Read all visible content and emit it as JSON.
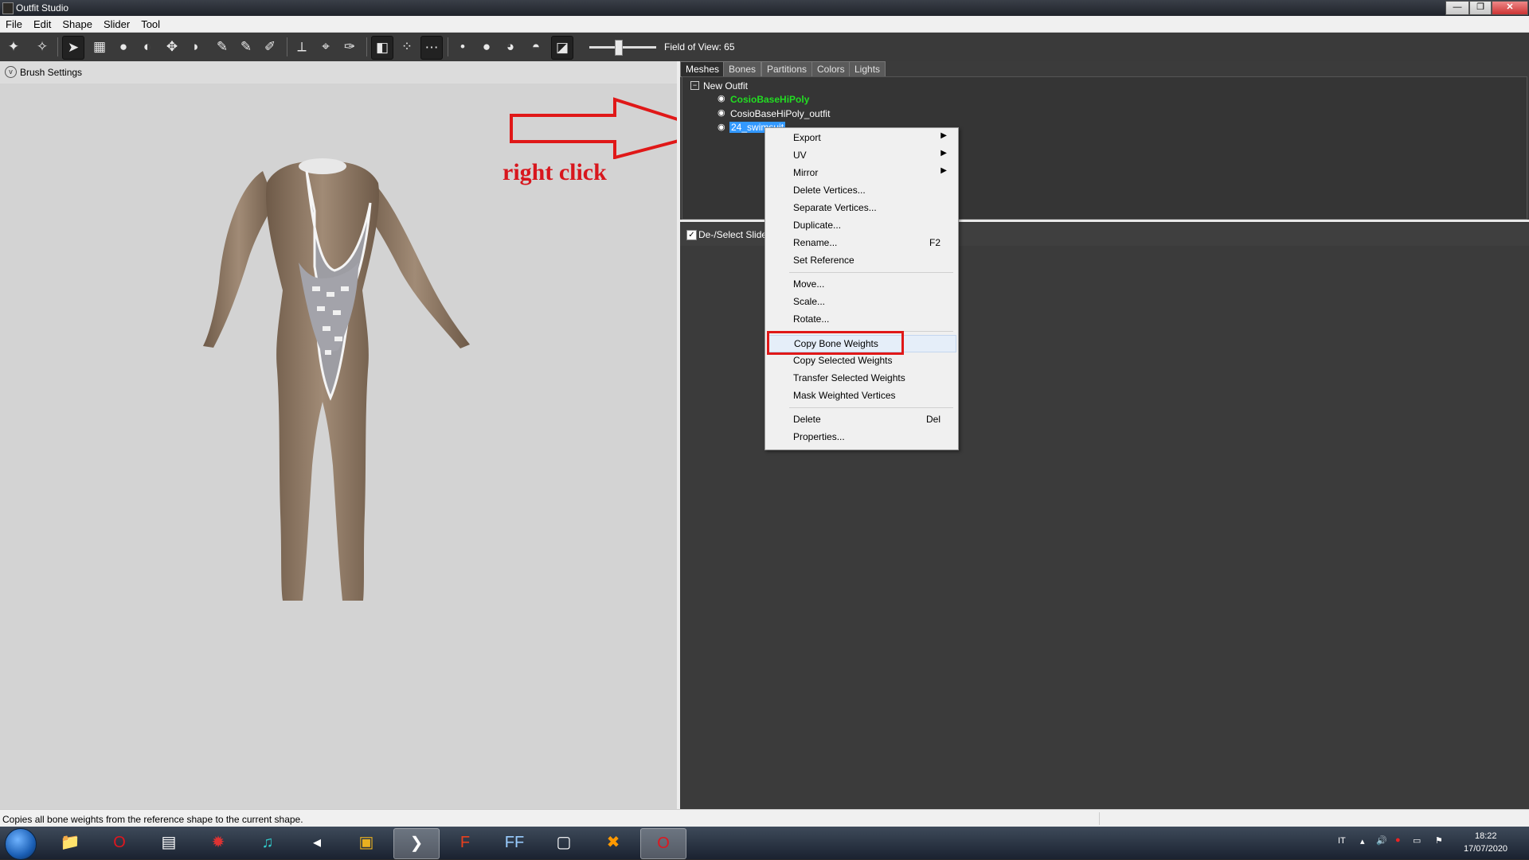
{
  "window": {
    "title": "Outfit Studio",
    "buttons": [
      "—",
      "❐",
      "✕"
    ]
  },
  "menubar": {
    "items": [
      "File",
      "Edit",
      "Shape",
      "Slider",
      "Tool"
    ]
  },
  "toolbar": {
    "field_of_view_label": "Field of View: 65",
    "fov_value": 65
  },
  "left_panel": {
    "brush_settings_label": "Brush Settings"
  },
  "right_panel": {
    "tabs": [
      "Meshes",
      "Bones",
      "Partitions",
      "Colors",
      "Lights"
    ],
    "selected_tab": "Meshes",
    "tree": {
      "root": "New Outfit",
      "items": [
        {
          "label": "CosioBaseHiPoly",
          "color": "#22dd22"
        },
        {
          "label": "CosioBaseHiPoly_outfit",
          "color": "#ffffff"
        },
        {
          "label": "24_swimsuit",
          "selected": true
        }
      ]
    },
    "slider_toggle_label": "De-/Select Sliders"
  },
  "context_menu": {
    "items": [
      {
        "label": "Export",
        "submenu": true
      },
      {
        "label": "UV",
        "submenu": true
      },
      {
        "label": "Mirror",
        "submenu": true
      },
      {
        "label": "Delete Vertices..."
      },
      {
        "label": "Separate Vertices..."
      },
      {
        "label": "Duplicate..."
      },
      {
        "label": "Rename...",
        "shortcut": "F2"
      },
      {
        "label": "Set Reference"
      },
      {
        "label": "Move..."
      },
      {
        "label": "Scale..."
      },
      {
        "label": "Rotate..."
      },
      {
        "label": "Copy Bone Weights",
        "highlighted": true
      },
      {
        "label": "Copy Selected Weights"
      },
      {
        "label": "Transfer Selected Weights"
      },
      {
        "label": "Mask Weighted Vertices"
      },
      {
        "label": "Delete",
        "shortcut": "Del"
      },
      {
        "label": "Properties..."
      }
    ]
  },
  "annotation": {
    "text": "right click",
    "color": "#d8161d"
  },
  "statusbar": {
    "text": "Copies all bone weights from the reference shape to the current shape."
  },
  "taskbar": {
    "language": "IT",
    "time": "18:22",
    "date": "17/07/2020"
  },
  "colors": {
    "accent_red": "#e01818",
    "selection_blue": "#3399ff",
    "panel_dark": "#3b3b3b"
  }
}
